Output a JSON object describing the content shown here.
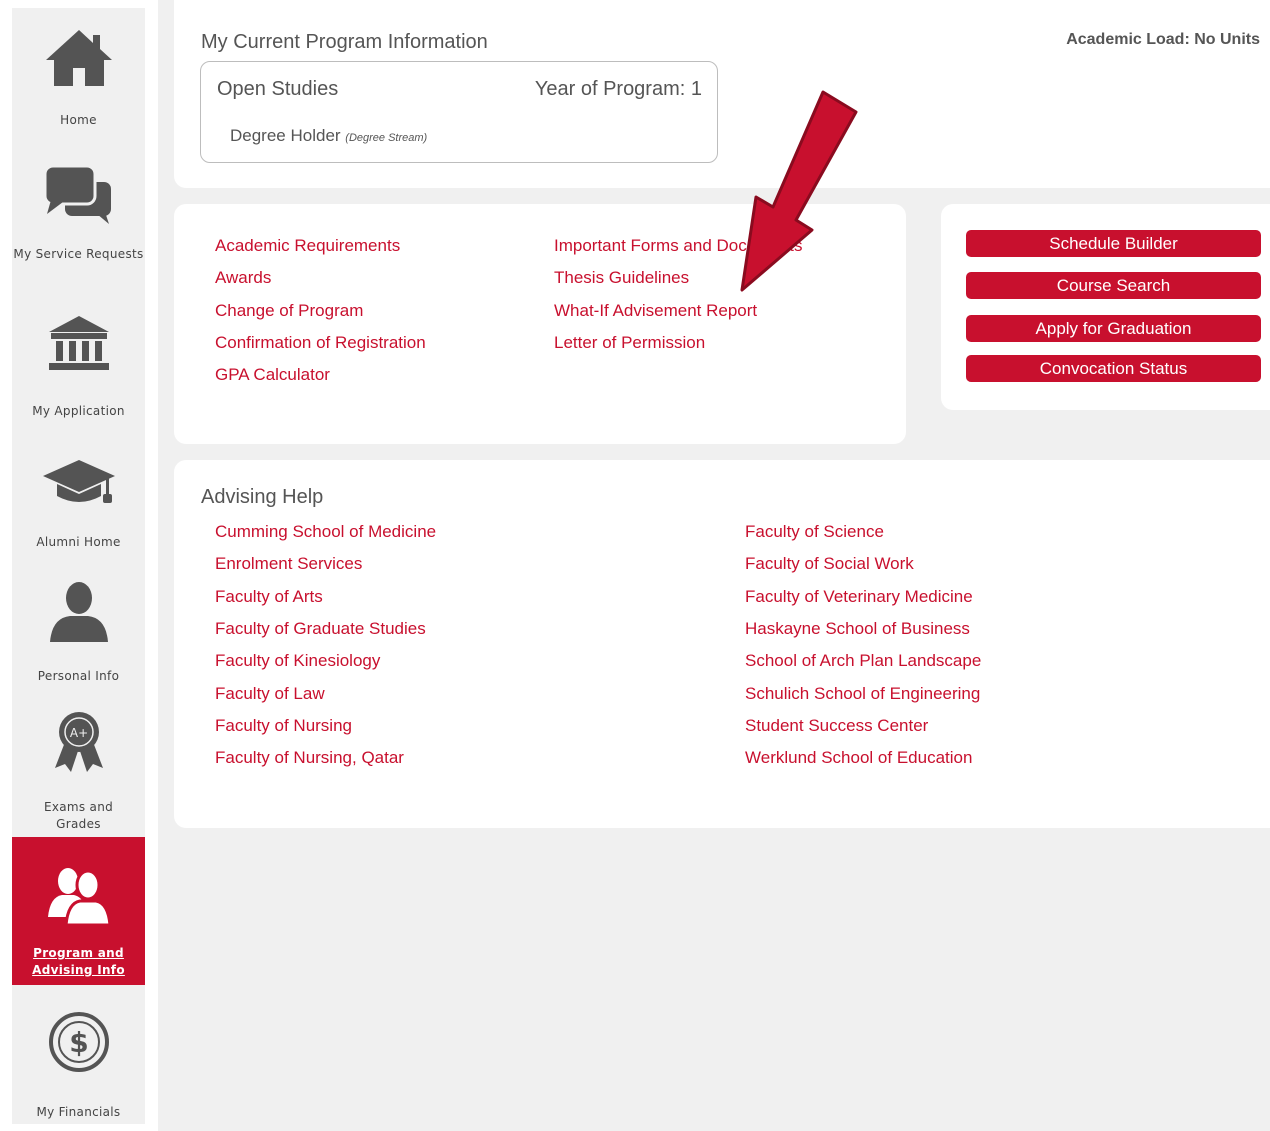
{
  "sidebar": {
    "items": [
      {
        "label": "Home",
        "icon": "home-icon"
      },
      {
        "label": "My Service Requests",
        "icon": "chat-bubbles-icon"
      },
      {
        "label": "My Application",
        "icon": "institution-icon"
      },
      {
        "label": "Alumni Home",
        "icon": "graduation-cap-icon"
      },
      {
        "label": "Personal Info",
        "icon": "person-icon"
      },
      {
        "label": "Exams and Grades",
        "icon": "award-ribbon-icon"
      },
      {
        "label": "Program and Advising Info",
        "icon": "people-icon",
        "active": true
      },
      {
        "label": "My Financials",
        "icon": "dollar-circle-icon"
      }
    ]
  },
  "program": {
    "title": "My Current Program Information",
    "academic_load": "Academic Load: No Units",
    "name": "Open Studies",
    "year": "Year of Program: 1",
    "plan": "Degree Holder",
    "plan_type": "(Degree Stream)"
  },
  "links": {
    "col1": [
      "Academic Requirements",
      "Awards",
      "Change of Program",
      "Confirmation of Registration",
      "GPA Calculator"
    ],
    "col2": [
      "Important Forms and Documents",
      "Thesis Guidelines",
      "What-If Advisement Report",
      "Letter of Permission"
    ]
  },
  "actions": [
    "Schedule Builder",
    "Course Search",
    "Apply for Graduation",
    "Convocation Status"
  ],
  "advising": {
    "title": "Advising Help",
    "col1": [
      "Cumming School of Medicine",
      "Enrolment Services",
      "Faculty of Arts",
      "Faculty of Graduate Studies",
      "Faculty of Kinesiology",
      "Faculty of Law",
      "Faculty of Nursing",
      "Faculty of Nursing, Qatar"
    ],
    "col2": [
      "Faculty of Science",
      "Faculty of Social Work",
      "Faculty of Veterinary Medicine",
      "Haskayne School of Business",
      "School of Arch Plan Landscape",
      "Schulich School of Engineering",
      "Student Success Center",
      "Werklund School of Education"
    ]
  },
  "colors": {
    "brand_red": "#c8102e",
    "icon_gray": "#545454",
    "panel_bg": "#f0f0f0"
  }
}
